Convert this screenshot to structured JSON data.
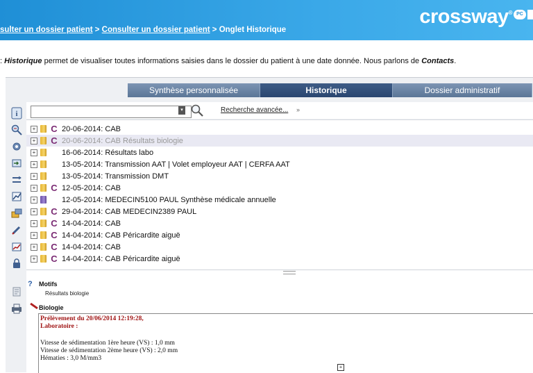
{
  "header": {
    "breadcrumb_part1": "sulter un dossier patient",
    "breadcrumb_sep1": " > ",
    "breadcrumb_part2": "Consulter un dossier patient",
    "breadcrumb_sep2": " > Onglet Historique",
    "brand": "crossway",
    "brand_mark": "®",
    "badge": "PC"
  },
  "intro": {
    "prefix": ": ",
    "term1": "Historique",
    "middle": " permet de visualiser toutes informations saisies dans le dossier du patient à une date donnée. Nous parlons de ",
    "term2": "Contacts",
    "suffix": "."
  },
  "tabs": [
    {
      "label": "Synthèse personnalisée",
      "active": false
    },
    {
      "label": "Historique",
      "active": true
    },
    {
      "label": "Dossier administratif",
      "active": false
    }
  ],
  "search": {
    "value": "",
    "advanced_label": "Recherche avancée...",
    "advanced_chevron": "»"
  },
  "history_rows": [
    {
      "c": "C",
      "text": "20-06-2014: CAB",
      "folder": "yellow",
      "selected": false
    },
    {
      "c": "C",
      "text": "20-06-2014: CAB  Résultats biologie",
      "folder": "yellow",
      "selected": true
    },
    {
      "c": "",
      "text": "16-06-2014:  Résultats labo",
      "folder": "yellow",
      "selected": false
    },
    {
      "c": "",
      "text": "13-05-2014:  Transmission AAT | Volet employeur AAT | CERFA AAT",
      "folder": "yellow",
      "selected": false
    },
    {
      "c": "",
      "text": "13-05-2014:  Transmission DMT",
      "folder": "yellow",
      "selected": false
    },
    {
      "c": "C",
      "text": "12-05-2014: CAB",
      "folder": "yellow",
      "selected": false
    },
    {
      "c": "",
      "text": "12-05-2014:  MEDECIN5100 PAUL Synthèse médicale annuelle",
      "folder": "purple",
      "selected": false
    },
    {
      "c": "C",
      "text": "29-04-2014: CAB MEDECIN2389 PAUL",
      "folder": "yellow",
      "selected": false
    },
    {
      "c": "C",
      "text": "14-04-2014: CAB",
      "folder": "yellow",
      "selected": false
    },
    {
      "c": "C",
      "text": "14-04-2014: CAB  Péricardite aiguë",
      "folder": "yellow",
      "selected": false
    },
    {
      "c": "C",
      "text": "14-04-2014: CAB",
      "folder": "yellow",
      "selected": false
    },
    {
      "c": "C",
      "text": "14-04-2014: CAB  Péricardite aiguë",
      "folder": "yellow",
      "selected": false
    }
  ],
  "detail": {
    "motifs_title": "Motifs",
    "motifs_value": "Résultats biologie",
    "bio_title": "Biologie",
    "bio_lines": [
      "Prélèvement du 20/06/2014 12:19:28,",
      "Laboratoire :",
      "Vitesse de sédimentation 1ère heure (VS) : 1,0 mm",
      "Vitesse de sédimentation 2ème heure (VS) : 2,0 mm",
      "Hématies : 3,0 M/mm3"
    ]
  },
  "icons": {
    "left_toolbar": [
      "info-icon",
      "zoom-icon",
      "settings-gear-icon",
      "import-icon",
      "compare-icon",
      "chart-icon",
      "transfer-icon",
      "edit-icon",
      "graph-icon",
      "lock-icon"
    ],
    "bottom_toolbar": [
      "print-preview-icon",
      "printer-icon"
    ]
  },
  "colors": {
    "header_blue": "#1f8fd6",
    "tab_active": "#2a4670",
    "tab_inactive": "#5b7697",
    "c_mark": "#7a2a73",
    "bio_red": "#a01515"
  }
}
